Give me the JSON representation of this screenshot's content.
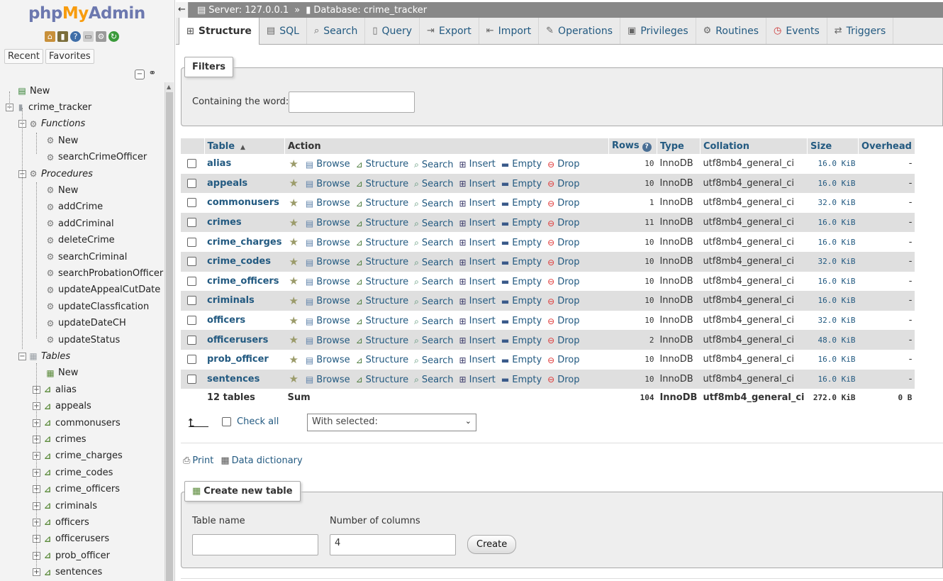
{
  "logo": {
    "part1": "php",
    "part2": "My",
    "part3": "Admin"
  },
  "nav": {
    "recent_label": "Recent",
    "favorites_label": "Favorites",
    "tree": [
      {
        "label": "New",
        "level": 0,
        "type": "new"
      },
      {
        "label": "crime_tracker",
        "level": 0,
        "type": "db"
      },
      {
        "label": "Functions",
        "level": 1,
        "type": "group"
      },
      {
        "label": "New",
        "level": 2,
        "type": "new-gear"
      },
      {
        "label": "searchCrimeOfficer",
        "level": 2,
        "type": "gear"
      },
      {
        "label": "Procedures",
        "level": 1,
        "type": "group"
      },
      {
        "label": "New",
        "level": 2,
        "type": "new-gear"
      },
      {
        "label": "addCrime",
        "level": 2,
        "type": "gear"
      },
      {
        "label": "addCriminal",
        "level": 2,
        "type": "gear"
      },
      {
        "label": "deleteCrime",
        "level": 2,
        "type": "gear"
      },
      {
        "label": "searchCriminal",
        "level": 2,
        "type": "gear"
      },
      {
        "label": "searchProbationOfficer",
        "level": 2,
        "type": "gear"
      },
      {
        "label": "updateAppealCutDate",
        "level": 2,
        "type": "gear"
      },
      {
        "label": "updateClassfication",
        "level": 2,
        "type": "gear"
      },
      {
        "label": "updateDateCH",
        "level": 2,
        "type": "gear"
      },
      {
        "label": "updateStatus",
        "level": 2,
        "type": "gear"
      },
      {
        "label": "Tables",
        "level": 1,
        "type": "tables"
      },
      {
        "label": "New",
        "level": 2,
        "type": "new-table"
      },
      {
        "label": "alias",
        "level": 2,
        "type": "table"
      },
      {
        "label": "appeals",
        "level": 2,
        "type": "table"
      },
      {
        "label": "commonusers",
        "level": 2,
        "type": "table"
      },
      {
        "label": "crimes",
        "level": 2,
        "type": "table"
      },
      {
        "label": "crime_charges",
        "level": 2,
        "type": "table"
      },
      {
        "label": "crime_codes",
        "level": 2,
        "type": "table"
      },
      {
        "label": "crime_officers",
        "level": 2,
        "type": "table"
      },
      {
        "label": "criminals",
        "level": 2,
        "type": "table"
      },
      {
        "label": "officers",
        "level": 2,
        "type": "table"
      },
      {
        "label": "officerusers",
        "level": 2,
        "type": "table"
      },
      {
        "label": "prob_officer",
        "level": 2,
        "type": "table"
      },
      {
        "label": "sentences",
        "level": 2,
        "type": "table"
      }
    ]
  },
  "breadcrumb": {
    "server": "Server: 127.0.0.1",
    "separator": "»",
    "database": "Database: crime_tracker"
  },
  "tabs": [
    {
      "label": "Structure",
      "icon": "structure-icon",
      "active": true
    },
    {
      "label": "SQL",
      "icon": "sql-icon"
    },
    {
      "label": "Search",
      "icon": "search-icon"
    },
    {
      "label": "Query",
      "icon": "query-icon"
    },
    {
      "label": "Export",
      "icon": "export-icon"
    },
    {
      "label": "Import",
      "icon": "import-icon"
    },
    {
      "label": "Operations",
      "icon": "operations-icon"
    },
    {
      "label": "Privileges",
      "icon": "privileges-icon"
    },
    {
      "label": "Routines",
      "icon": "routines-icon"
    },
    {
      "label": "Events",
      "icon": "events-icon"
    },
    {
      "label": "Triggers",
      "icon": "triggers-icon"
    }
  ],
  "filters": {
    "legend": "Filters",
    "label": "Containing the word:",
    "value": ""
  },
  "table": {
    "headers": {
      "table": "Table",
      "action": "Action",
      "rows": "Rows",
      "type": "Type",
      "collation": "Collation",
      "size": "Size",
      "overhead": "Overhead"
    },
    "actions": [
      "Browse",
      "Structure",
      "Search",
      "Insert",
      "Empty",
      "Drop"
    ],
    "rows": [
      {
        "name": "alias",
        "rows": "10",
        "type": "InnoDB",
        "collation": "utf8mb4_general_ci",
        "size": "16.0 KiB",
        "overhead": "-"
      },
      {
        "name": "appeals",
        "rows": "10",
        "type": "InnoDB",
        "collation": "utf8mb4_general_ci",
        "size": "16.0 KiB",
        "overhead": "-"
      },
      {
        "name": "commonusers",
        "rows": "1",
        "type": "InnoDB",
        "collation": "utf8mb4_general_ci",
        "size": "32.0 KiB",
        "overhead": "-"
      },
      {
        "name": "crimes",
        "rows": "11",
        "type": "InnoDB",
        "collation": "utf8mb4_general_ci",
        "size": "16.0 KiB",
        "overhead": "-"
      },
      {
        "name": "crime_charges",
        "rows": "10",
        "type": "InnoDB",
        "collation": "utf8mb4_general_ci",
        "size": "16.0 KiB",
        "overhead": "-"
      },
      {
        "name": "crime_codes",
        "rows": "10",
        "type": "InnoDB",
        "collation": "utf8mb4_general_ci",
        "size": "32.0 KiB",
        "overhead": "-"
      },
      {
        "name": "crime_officers",
        "rows": "10",
        "type": "InnoDB",
        "collation": "utf8mb4_general_ci",
        "size": "16.0 KiB",
        "overhead": "-"
      },
      {
        "name": "criminals",
        "rows": "10",
        "type": "InnoDB",
        "collation": "utf8mb4_general_ci",
        "size": "16.0 KiB",
        "overhead": "-"
      },
      {
        "name": "officers",
        "rows": "10",
        "type": "InnoDB",
        "collation": "utf8mb4_general_ci",
        "size": "32.0 KiB",
        "overhead": "-"
      },
      {
        "name": "officerusers",
        "rows": "2",
        "type": "InnoDB",
        "collation": "utf8mb4_general_ci",
        "size": "48.0 KiB",
        "overhead": "-"
      },
      {
        "name": "prob_officer",
        "rows": "10",
        "type": "InnoDB",
        "collation": "utf8mb4_general_ci",
        "size": "16.0 KiB",
        "overhead": "-"
      },
      {
        "name": "sentences",
        "rows": "10",
        "type": "InnoDB",
        "collation": "utf8mb4_general_ci",
        "size": "16.0 KiB",
        "overhead": "-"
      }
    ],
    "summary": {
      "count": "12 tables",
      "label": "Sum",
      "rows": "104",
      "type": "InnoDB",
      "collation": "utf8mb4_general_ci",
      "size": "272.0 KiB",
      "overhead": "0 B"
    }
  },
  "bulk": {
    "check_all": "Check all",
    "with_selected": "With selected:"
  },
  "links": {
    "print": "Print",
    "data_dictionary": "Data dictionary"
  },
  "create_table": {
    "legend": "Create new table",
    "table_name_label": "Table name",
    "table_name_value": "",
    "columns_label": "Number of columns",
    "columns_value": "4",
    "create_button": "Create"
  },
  "colors": {
    "link": "#235a81",
    "row_even": "#dfdfdf",
    "header_bg": "#e0e0e0",
    "topbar": "#888888"
  }
}
